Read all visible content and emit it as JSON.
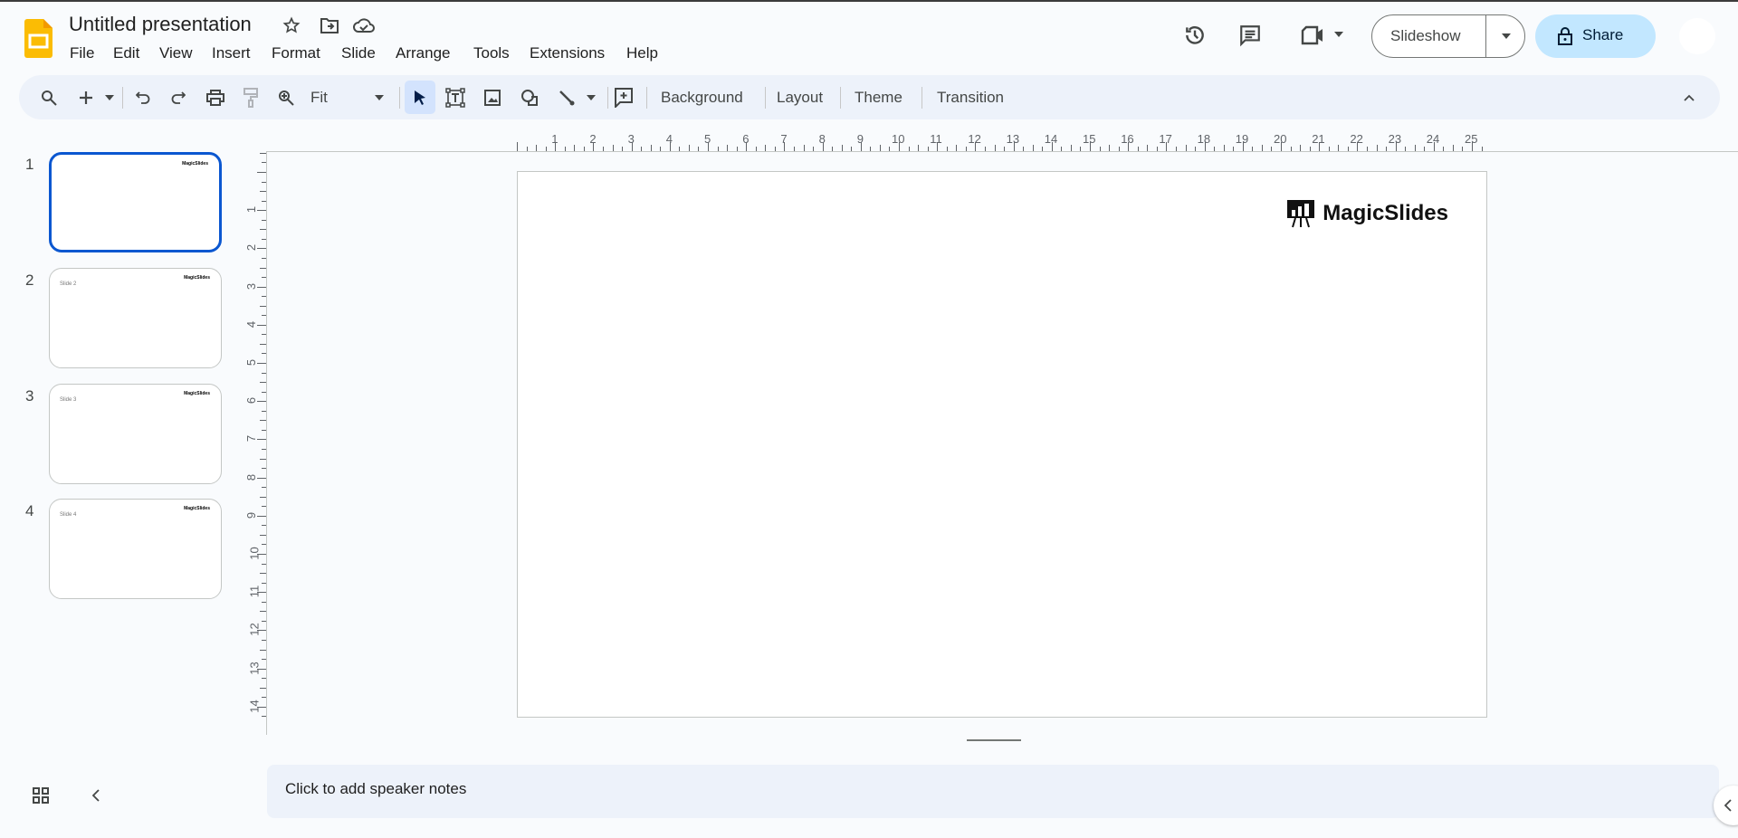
{
  "app": {
    "title": "Untitled presentation"
  },
  "menu": [
    "File",
    "Edit",
    "View",
    "Insert",
    "Format",
    "Slide",
    "Arrange",
    "Tools",
    "Extensions",
    "Help"
  ],
  "header": {
    "slideshow_label": "Slideshow",
    "share_label": "Share"
  },
  "toolbar": {
    "zoom_value": "Fit",
    "background": "Background",
    "layout": "Layout",
    "theme": "Theme",
    "transition": "Transition"
  },
  "slides": [
    {
      "number": "1",
      "label": "",
      "logo": "MagicSlides"
    },
    {
      "number": "2",
      "label": "Slide 2",
      "logo": "MagicSlides"
    },
    {
      "number": "3",
      "label": "Slide 3",
      "logo": "MagicSlides"
    },
    {
      "number": "4",
      "label": "Slide 4",
      "logo": "MagicSlides"
    }
  ],
  "canvas": {
    "logo_text": "MagicSlides"
  },
  "ruler": {
    "horizontal": [
      "1",
      "2",
      "3",
      "4",
      "5",
      "6",
      "7",
      "8",
      "9",
      "10",
      "11",
      "12",
      "13",
      "14",
      "15",
      "16",
      "17",
      "18",
      "19",
      "20",
      "21",
      "22",
      "23",
      "24",
      "25"
    ],
    "vertical": [
      "1",
      "2",
      "3",
      "4",
      "5",
      "6",
      "7",
      "8",
      "9",
      "10",
      "11",
      "12",
      "13",
      "14"
    ]
  },
  "notes": {
    "placeholder": "Click to add speaker notes"
  },
  "colors": {
    "accent": "#0b57d0",
    "share_bg": "#c2e7ff",
    "toolbar_bg": "#edf2fa",
    "slides_icon": "#fbbc04"
  }
}
